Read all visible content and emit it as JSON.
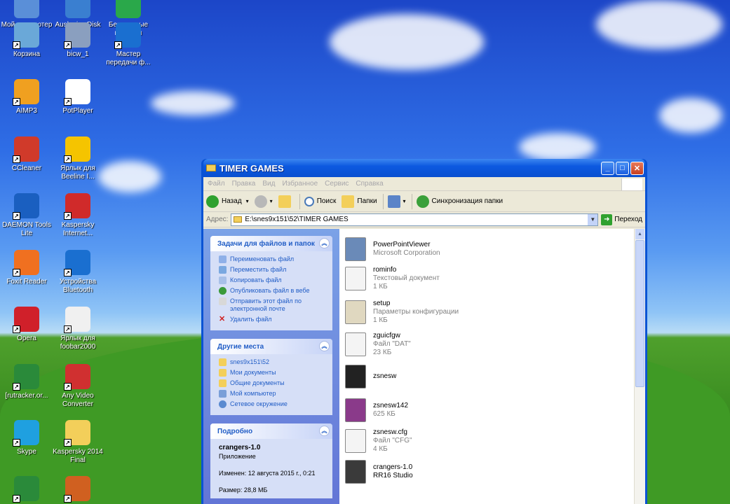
{
  "desktop": {
    "icons": [
      {
        "label": "Мой компьютер",
        "icon": "computer-icon",
        "color": "#5a8fd8"
      },
      {
        "label": "Auslogics Disk Defrag",
        "icon": "defrag-icon",
        "color": "#3a7fd0"
      },
      {
        "label": "Безопасные платежи",
        "icon": "kaspersky-payments-icon",
        "color": "#2aa84a"
      },
      {
        "label": "Корзина",
        "icon": "recycle-bin-icon",
        "color": "#6aa8d8"
      },
      {
        "label": "bicw_1",
        "icon": "installer-icon",
        "color": "#8a9fbf"
      },
      {
        "label": "Мастер передачи ф...",
        "icon": "bluetooth-icon",
        "color": "#1a6fd0"
      },
      {
        "label": "AIMP3",
        "icon": "aimp-icon",
        "color": "#f0a020"
      },
      {
        "label": "PotPlayer",
        "icon": "potplayer-icon",
        "color": "#ffffff"
      },
      {
        "label": "CCleaner",
        "icon": "ccleaner-icon",
        "color": "#d03a2a"
      },
      {
        "label": "Ярлык для Beeline I...",
        "icon": "beeline-icon",
        "color": "#f5c400"
      },
      {
        "label": "DAEMON Tools Lite",
        "icon": "daemon-tools-icon",
        "color": "#1a5fc0"
      },
      {
        "label": "Kaspersky Internet...",
        "icon": "kaspersky-icon",
        "color": "#d02a2a"
      },
      {
        "label": "Foxit Reader",
        "icon": "foxit-icon",
        "color": "#f07020"
      },
      {
        "label": "Устройства Bluetooth",
        "icon": "bluetooth-devices-icon",
        "color": "#1a6fd0"
      },
      {
        "label": "Opera",
        "icon": "opera-icon",
        "color": "#d0202a"
      },
      {
        "label": "Ярлык для foobar2000",
        "icon": "foobar-icon",
        "color": "#f0f0f0"
      },
      {
        "label": "[rutracker.or...",
        "icon": "utorrent-icon",
        "color": "#2a8a3a"
      },
      {
        "label": "Any Video Converter",
        "icon": "video-converter-icon",
        "color": "#d03030"
      },
      {
        "label": "Skype",
        "icon": "skype-icon",
        "color": "#1fa0e0"
      },
      {
        "label": "Kaspersky 2014 Final",
        "icon": "folder-icon",
        "color": "#f3cf5a"
      },
      {
        "label": "",
        "icon": "utorrent-icon",
        "color": "#2a8a3a"
      },
      {
        "label": "",
        "icon": "app-icon",
        "color": "#d06020"
      }
    ]
  },
  "window": {
    "title": "TIMER GAMES",
    "menu": [
      "Файл",
      "Правка",
      "Вид",
      "Избранное",
      "Сервис",
      "Справка"
    ],
    "toolbar": {
      "back": "Назад",
      "search": "Поиск",
      "folders": "Папки",
      "sync": "Синхронизация папки"
    },
    "address": {
      "label": "Адрес:",
      "value": "E:\\snes9x151\\52\\TIMER GAMES",
      "go": "Переход"
    },
    "tasks": {
      "title": "Задачи для файлов и папок",
      "items": [
        "Переименовать файл",
        "Переместить файл",
        "Копировать файл",
        "Опубликовать файл в вебе",
        "Отправить этот файл по электронной почте",
        "Удалить файл"
      ]
    },
    "places": {
      "title": "Другие места",
      "items": [
        "snes9x151\\52",
        "Мои документы",
        "Общие документы",
        "Мой компьютер",
        "Сетевое окружение"
      ]
    },
    "details": {
      "title": "Подробно",
      "name": "crangers-1.0",
      "type": "Приложение",
      "modified": "Изменен: 12 августа 2015 г., 0:21",
      "size": "Размер: 28,8 МБ"
    },
    "files": [
      {
        "name": "PowerPointViewer",
        "line2": "Microsoft Corporation",
        "line3": "",
        "icon": "installer-icon"
      },
      {
        "name": "rominfo",
        "line2": "Текстовый документ",
        "line3": "1 КБ",
        "icon": "text-document-icon"
      },
      {
        "name": "setup",
        "line2": "Параметры конфигурации",
        "line3": "1 КБ",
        "icon": "config-file-icon"
      },
      {
        "name": "zguicfgw",
        "line2": "Файл \"DAT\"",
        "line3": "23 КБ",
        "icon": "dat-file-icon"
      },
      {
        "name": "zsnesw",
        "line2": "",
        "line3": "",
        "icon": "zsnes-icon"
      },
      {
        "name": "zsnesw142",
        "line2": "625 КБ",
        "line3": "",
        "icon": "winrar-archive-icon"
      },
      {
        "name": "zsnesw.cfg",
        "line2": "Файл \"CFG\"",
        "line3": "4 КБ",
        "icon": "cfg-file-icon"
      },
      {
        "name": "crangers-1.0",
        "line2": "RR16 Studio",
        "line3": "",
        "icon": "game-exe-icon"
      }
    ]
  },
  "colors": {
    "xp_blue": "#0a53d4",
    "link_blue": "#215dc6",
    "panel_bg": "#d6dff7"
  }
}
